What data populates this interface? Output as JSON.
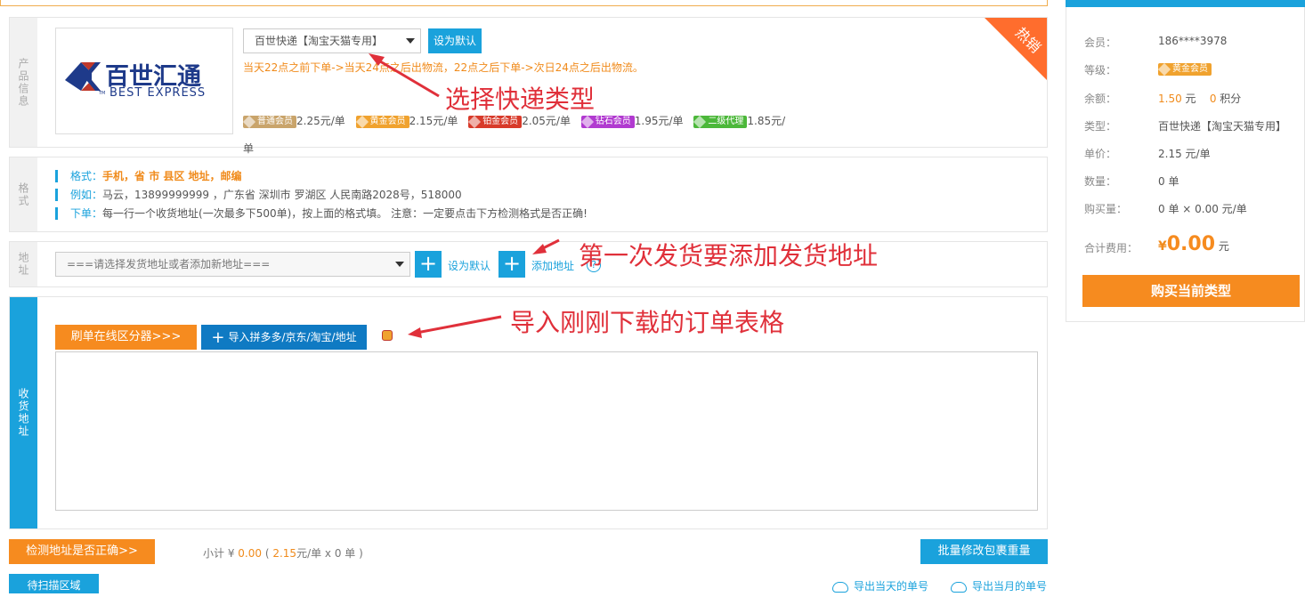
{
  "product": {
    "section_label": "产品信息",
    "logo_cn": "百世汇通",
    "logo_en": "BEST EXPRESS",
    "logo_tm": "TM",
    "express_select": "百世快递【淘宝天猫专用】",
    "set_default": "设为默认",
    "note": "当天22点之前下单->当天24点之后出物流，22点之后下单->次日24点之后出物流。",
    "hot": "热销",
    "prices": [
      {
        "level": "普通会员",
        "price": "2.25元/单",
        "color": "#c9a46b"
      },
      {
        "level": "黄金会员",
        "price": "2.15元/单",
        "color": "#f0a22e"
      },
      {
        "level": "铂金会员",
        "price": "2.05元/单",
        "color": "#d83a2a"
      },
      {
        "level": "钻石会员",
        "price": "1.95元/单",
        "color": "#b13ad0"
      },
      {
        "level": "二级代理",
        "price": "1.85元/",
        "color": "#4cb83a"
      }
    ],
    "price_tail": "单"
  },
  "format": {
    "section_label": "格式",
    "line1_key": "格式：",
    "line1_val": "手机，省 市 县区 地址，邮编",
    "line2_key": "例如：",
    "line2_val": "马云，13899999999 ，广东省 深圳市 罗湖区 人民南路2028号，518000",
    "line3_key": "下单：",
    "line3_val": "每一行一个收货地址(一次最多下500单)，按上面的格式填。 注意：一定要点击下方检测格式是否正确!"
  },
  "address": {
    "section_label": "地址",
    "select_placeholder": "===请选择发货地址或者添加新地址===",
    "plus": "+",
    "set_default": "设为默认",
    "add_address": "添加地址",
    "help": "?"
  },
  "receive": {
    "section_label": "收货地址",
    "zone_btn": "刷单在线区分器>>>",
    "import_btn": "导入拼多多/京东/淘宝/地址"
  },
  "annotations": {
    "a1": "选择快递类型",
    "a2": "第一次发货要添加发货地址",
    "a3": "导入刚刚下载的订单表格"
  },
  "footer": {
    "check_btn": "检测地址是否正确>>",
    "subtotal_label": "小计 ¥",
    "subtotal_value": "0.00",
    "unit_price": "2.15",
    "unit_text": "元/单 x 0 单 )",
    "open_paren": "(",
    "batch_btn": "批量修改包裹重量",
    "scan_tab": "待扫描区域",
    "export_today": "导出当天的单号",
    "export_month": "导出当月的单号"
  },
  "side": {
    "member_k": "会员：",
    "member_v": "186****3978",
    "level_k": "等级：",
    "level_v": "黄金会员",
    "balance_k": "余额：",
    "balance_v": "1.50",
    "balance_unit": "元",
    "points_v": "0",
    "points_unit": "积分",
    "type_k": "类型：",
    "type_v": "百世快递【淘宝天猫专用】",
    "unit_k": "单价：",
    "unit_v": "2.15 元/单",
    "qty_k": "数量：",
    "qty_v": "0 单",
    "buyqty_k": "购买量：",
    "buyqty_v": "0 单 × 0.00 元/单",
    "total_k": "合计费用：",
    "total_currency": "¥",
    "total_v": "0.00",
    "total_unit": "元",
    "buy_btn": "购买当前类型"
  }
}
